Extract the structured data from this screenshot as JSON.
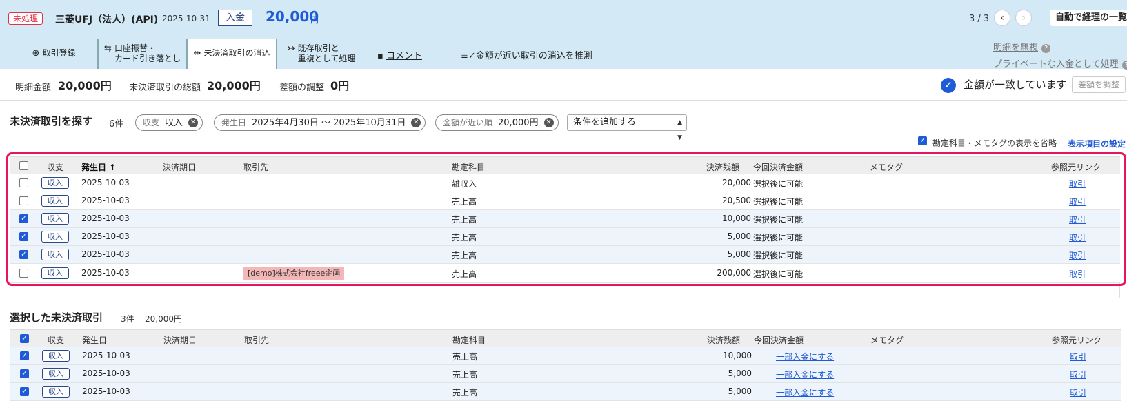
{
  "header": {
    "status": "未処理",
    "bank": "三菱UFJ（法人）(API)",
    "date": "2025-10-31",
    "type": "入金",
    "amount": "20,000",
    "currency": "円",
    "pager": "3 / 3",
    "auto_button": "自動で経理の一覧"
  },
  "tabs": [
    {
      "label": "取引登録"
    },
    {
      "label1": "口座振替・",
      "label2": "カード引き落とし"
    },
    {
      "label": "未決済取引の消込"
    },
    {
      "label1": "既存取引と",
      "label2": "重複として処理"
    },
    {
      "label": "コメント"
    },
    {
      "label": "金額が近い取引の消込を推測"
    }
  ],
  "side_links": {
    "ignore": "明細を無視",
    "private": "プライベートな入金として処理"
  },
  "summary": {
    "detail_label": "明細金額",
    "detail_value": "20,000円",
    "total_label": "未決済取引の総額",
    "total_value": "20,000円",
    "diff_label": "差額の調整",
    "diff_value": "0円",
    "match_text": "金額が一致しています",
    "adjust_button": "差額を調整"
  },
  "search": {
    "title": "未決済取引を探す",
    "count": "6件",
    "chips": [
      {
        "key": "収支",
        "value": "収入"
      },
      {
        "key": "発生日",
        "value": "2025年4月30日 〜 2025年10月31日"
      },
      {
        "key": "金額が近い順",
        "value": "20,000円"
      }
    ],
    "add_condition": "条件を追加する",
    "option_label": "勘定科目・メモタグの表示を省略",
    "display_settings": "表示項目の設定"
  },
  "columns": {
    "type": "収支",
    "date": "発生日",
    "sort_arrow": "↑",
    "due": "決済期日",
    "partner": "取引先",
    "account": "勘定科目",
    "balance": "決済残額",
    "this_amount": "今回決済金額",
    "memo": "メモタグ",
    "ref": "参照元リンク"
  },
  "rows": [
    {
      "type": "収入",
      "date": "2025-10-03",
      "partner": "",
      "account": "雑収入",
      "balance": "20,000",
      "this": "選択後に可能",
      "ref": "取引",
      "checked": false
    },
    {
      "type": "収入",
      "date": "2025-10-03",
      "partner": "",
      "account": "売上高",
      "balance": "20,500",
      "this": "選択後に可能",
      "ref": "取引",
      "checked": false
    },
    {
      "type": "収入",
      "date": "2025-10-03",
      "partner": "",
      "account": "売上高",
      "balance": "10,000",
      "this": "選択後に可能",
      "ref": "取引",
      "checked": true
    },
    {
      "type": "収入",
      "date": "2025-10-03",
      "partner": "",
      "account": "売上高",
      "balance": "5,000",
      "this": "選択後に可能",
      "ref": "取引",
      "checked": true
    },
    {
      "type": "収入",
      "date": "2025-10-03",
      "partner": "",
      "account": "売上高",
      "balance": "5,000",
      "this": "選択後に可能",
      "ref": "取引",
      "checked": true
    },
    {
      "type": "収入",
      "date": "2025-10-03",
      "partner": "[demo]株式会社freee企画",
      "account": "売上高",
      "balance": "200,000",
      "this": "選択後に可能",
      "ref": "取引",
      "checked": false
    }
  ],
  "selected": {
    "title": "選択した未決済取引",
    "count": "3件",
    "sum": "20,000円",
    "rows": [
      {
        "type": "収入",
        "date": "2025-10-03",
        "account": "売上高",
        "balance": "10,000",
        "this": "一部入金にする",
        "ref": "取引"
      },
      {
        "type": "収入",
        "date": "2025-10-03",
        "account": "売上高",
        "balance": "5,000",
        "this": "一部入金にする",
        "ref": "取引"
      },
      {
        "type": "収入",
        "date": "2025-10-03",
        "account": "売上高",
        "balance": "5,000",
        "this": "一部入金にする",
        "ref": "取引"
      }
    ]
  }
}
